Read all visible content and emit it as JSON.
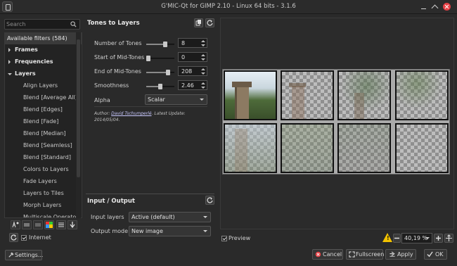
{
  "window": {
    "title": "G'MIC-Qt for GIMP 2.10 - Linux 64 bits - 3.1.6"
  },
  "search": {
    "placeholder": "Search"
  },
  "filters": {
    "header": "Available filters (584)",
    "categories": [
      {
        "label": "Frames",
        "expanded": false
      },
      {
        "label": "Frequencies",
        "expanded": false
      },
      {
        "label": "Layers",
        "expanded": true
      }
    ],
    "items": [
      "Align Layers",
      "Blend [Average All]",
      "Blend [Edges]",
      "Blend [Fade]",
      "Blend [Median]",
      "Blend [Seamless]",
      "Blend [Standard]",
      "Colors to Layers",
      "Fade Layers",
      "Layers to Tiles",
      "Morph Layers",
      "Multiscale Operator"
    ]
  },
  "left_bottom": {
    "internet_label": "Internet",
    "internet_checked": true,
    "settings_label": "Settings..."
  },
  "filter": {
    "title": "Tones to Layers",
    "params": [
      {
        "label": "Number of Tones",
        "value": "8",
        "fraction": 0.7
      },
      {
        "label": "Start of Mid-Tones",
        "value": "0",
        "fraction": 0.0
      },
      {
        "label": "End of Mid-Tones",
        "value": "208",
        "fraction": 0.82
      },
      {
        "label": "Smoothness",
        "value": "2.46",
        "fraction": 0.5
      }
    ],
    "alpha_label": "Alpha",
    "alpha_value": "Scalar",
    "author_prefix": "Author: ",
    "author_name": "David Tschumperlé",
    "update_prefix": ".    Latest Update: ",
    "update_date": "2014/05/04."
  },
  "io": {
    "title": "Input / Output",
    "input_label": "Input layers",
    "input_value": "Active (default)",
    "output_label": "Output mode",
    "output_value": "New image"
  },
  "preview": {
    "label": "Preview",
    "checked": true,
    "zoom": "40,19 %"
  },
  "buttons": {
    "cancel": "Cancel",
    "fullscreen": "Fullscreen",
    "apply": "Apply",
    "ok": "OK"
  },
  "colors": {
    "accent": "#e54045",
    "warning": "#f2c200",
    "link": "#c9c9ff"
  }
}
